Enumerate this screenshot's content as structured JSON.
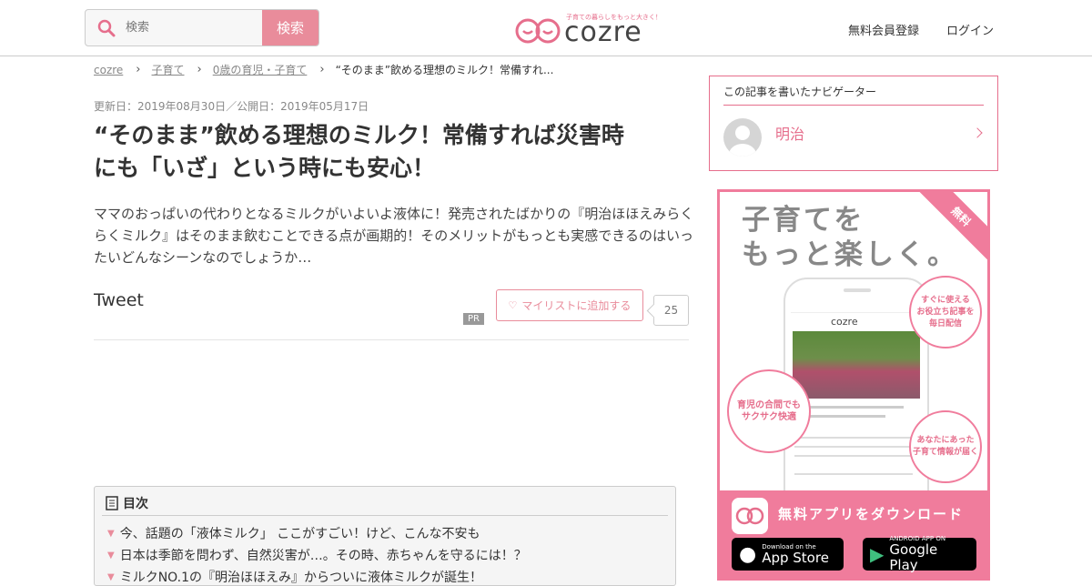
{
  "header": {
    "search_placeholder": "検索",
    "search_button": "検索",
    "logo_text": "cozre",
    "logo_tagline": "子育ての暮らしをもっと大きく！",
    "nav": {
      "register": "無料会員登録",
      "login": "ログイン"
    }
  },
  "breadcrumb": {
    "items": [
      "cozre",
      "子育て",
      "0歳の育児・子育て"
    ],
    "current": "“そのまま”飲める理想のミルク！常備すれ..."
  },
  "article": {
    "dates": "更新日：2019年08月30日／公開日：2019年05月17日",
    "title": "“そのまま”飲める理想のミルク！常備すれば災害時にも「いざ」という時にも安心！",
    "lead": "ママのおっぱいの代わりとなるミルクがいよいよ液体に！発売されたばかりの『明治ほほえみらくらくミルク』はそのまま飲むことできる点が画期的！そのメリットがもっとも実感できるのはいったいどんなシーンなのでしょうか…",
    "tweet": "Tweet",
    "pr": "PR",
    "mylist_label": "マイリストに追加する",
    "mylist_count": "25"
  },
  "toc": {
    "heading": "目次",
    "items": [
      "今、話題の「液体ミルク」 ここがすごい！けど、こんな不安も",
      "日本は季節を問わず、自然災害が…。その時、赤ちゃんを守るには！？",
      "ミルクNO.1の『明治ほほえみ』からついに液体ミルクが誕生！"
    ]
  },
  "navigator": {
    "heading": "この記事を書いたナビゲーター",
    "name": "明治"
  },
  "ad": {
    "heading_line1": "子育てを",
    "heading_line2": "もっと楽しく。",
    "ribbon": "無料",
    "bubble_top": "すぐに使える\nお役立ち記事を\n毎日配信",
    "bubble_left": "育児の合間でも\nサクサク快適",
    "bubble_right": "あなたにあった\n子育て情報が届く",
    "download": "無料アプリをダウンロード",
    "app_store_small": "Download on the",
    "app_store_big": "App Store",
    "google_small": "ANDROID APP ON",
    "google_big": "Google Play",
    "phone_logo": "cozre"
  }
}
